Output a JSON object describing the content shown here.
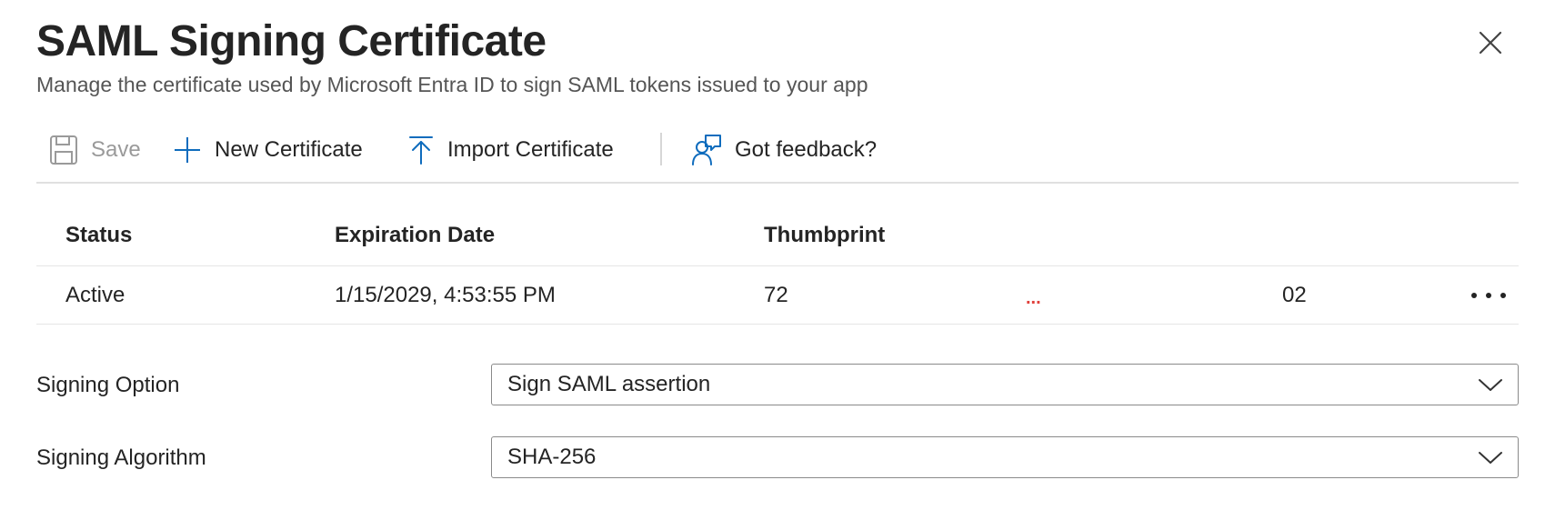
{
  "header": {
    "title": "SAML Signing Certificate",
    "subtitle": "Manage the certificate used by Microsoft Entra ID to sign SAML tokens issued to your app"
  },
  "toolbar": {
    "save_label": "Save",
    "new_certificate_label": "New Certificate",
    "import_certificate_label": "Import Certificate",
    "feedback_label": "Got feedback?"
  },
  "table": {
    "columns": [
      "Status",
      "Expiration Date",
      "Thumbprint"
    ],
    "rows": [
      {
        "status": "Active",
        "expiration_date": "1/15/2029, 4:53:55 PM",
        "thumbprint_start": "72",
        "thumbprint_truncation": "...",
        "thumbprint_end": "02"
      }
    ]
  },
  "form": {
    "signing_option": {
      "label": "Signing Option",
      "value": "Sign SAML assertion"
    },
    "signing_algorithm": {
      "label": "Signing Algorithm",
      "value": "SHA-256"
    }
  },
  "colors": {
    "accent": "#0f6cbd",
    "truncation": "#e0413c",
    "disabled": "#9a9a9a"
  },
  "icons": {
    "close": "close-icon",
    "save": "save-icon",
    "new_certificate": "plus-icon",
    "import_certificate": "upload-icon",
    "feedback": "feedback-icon",
    "row_more": "more-horizontal-icon",
    "dropdown": "chevron-down-icon"
  }
}
